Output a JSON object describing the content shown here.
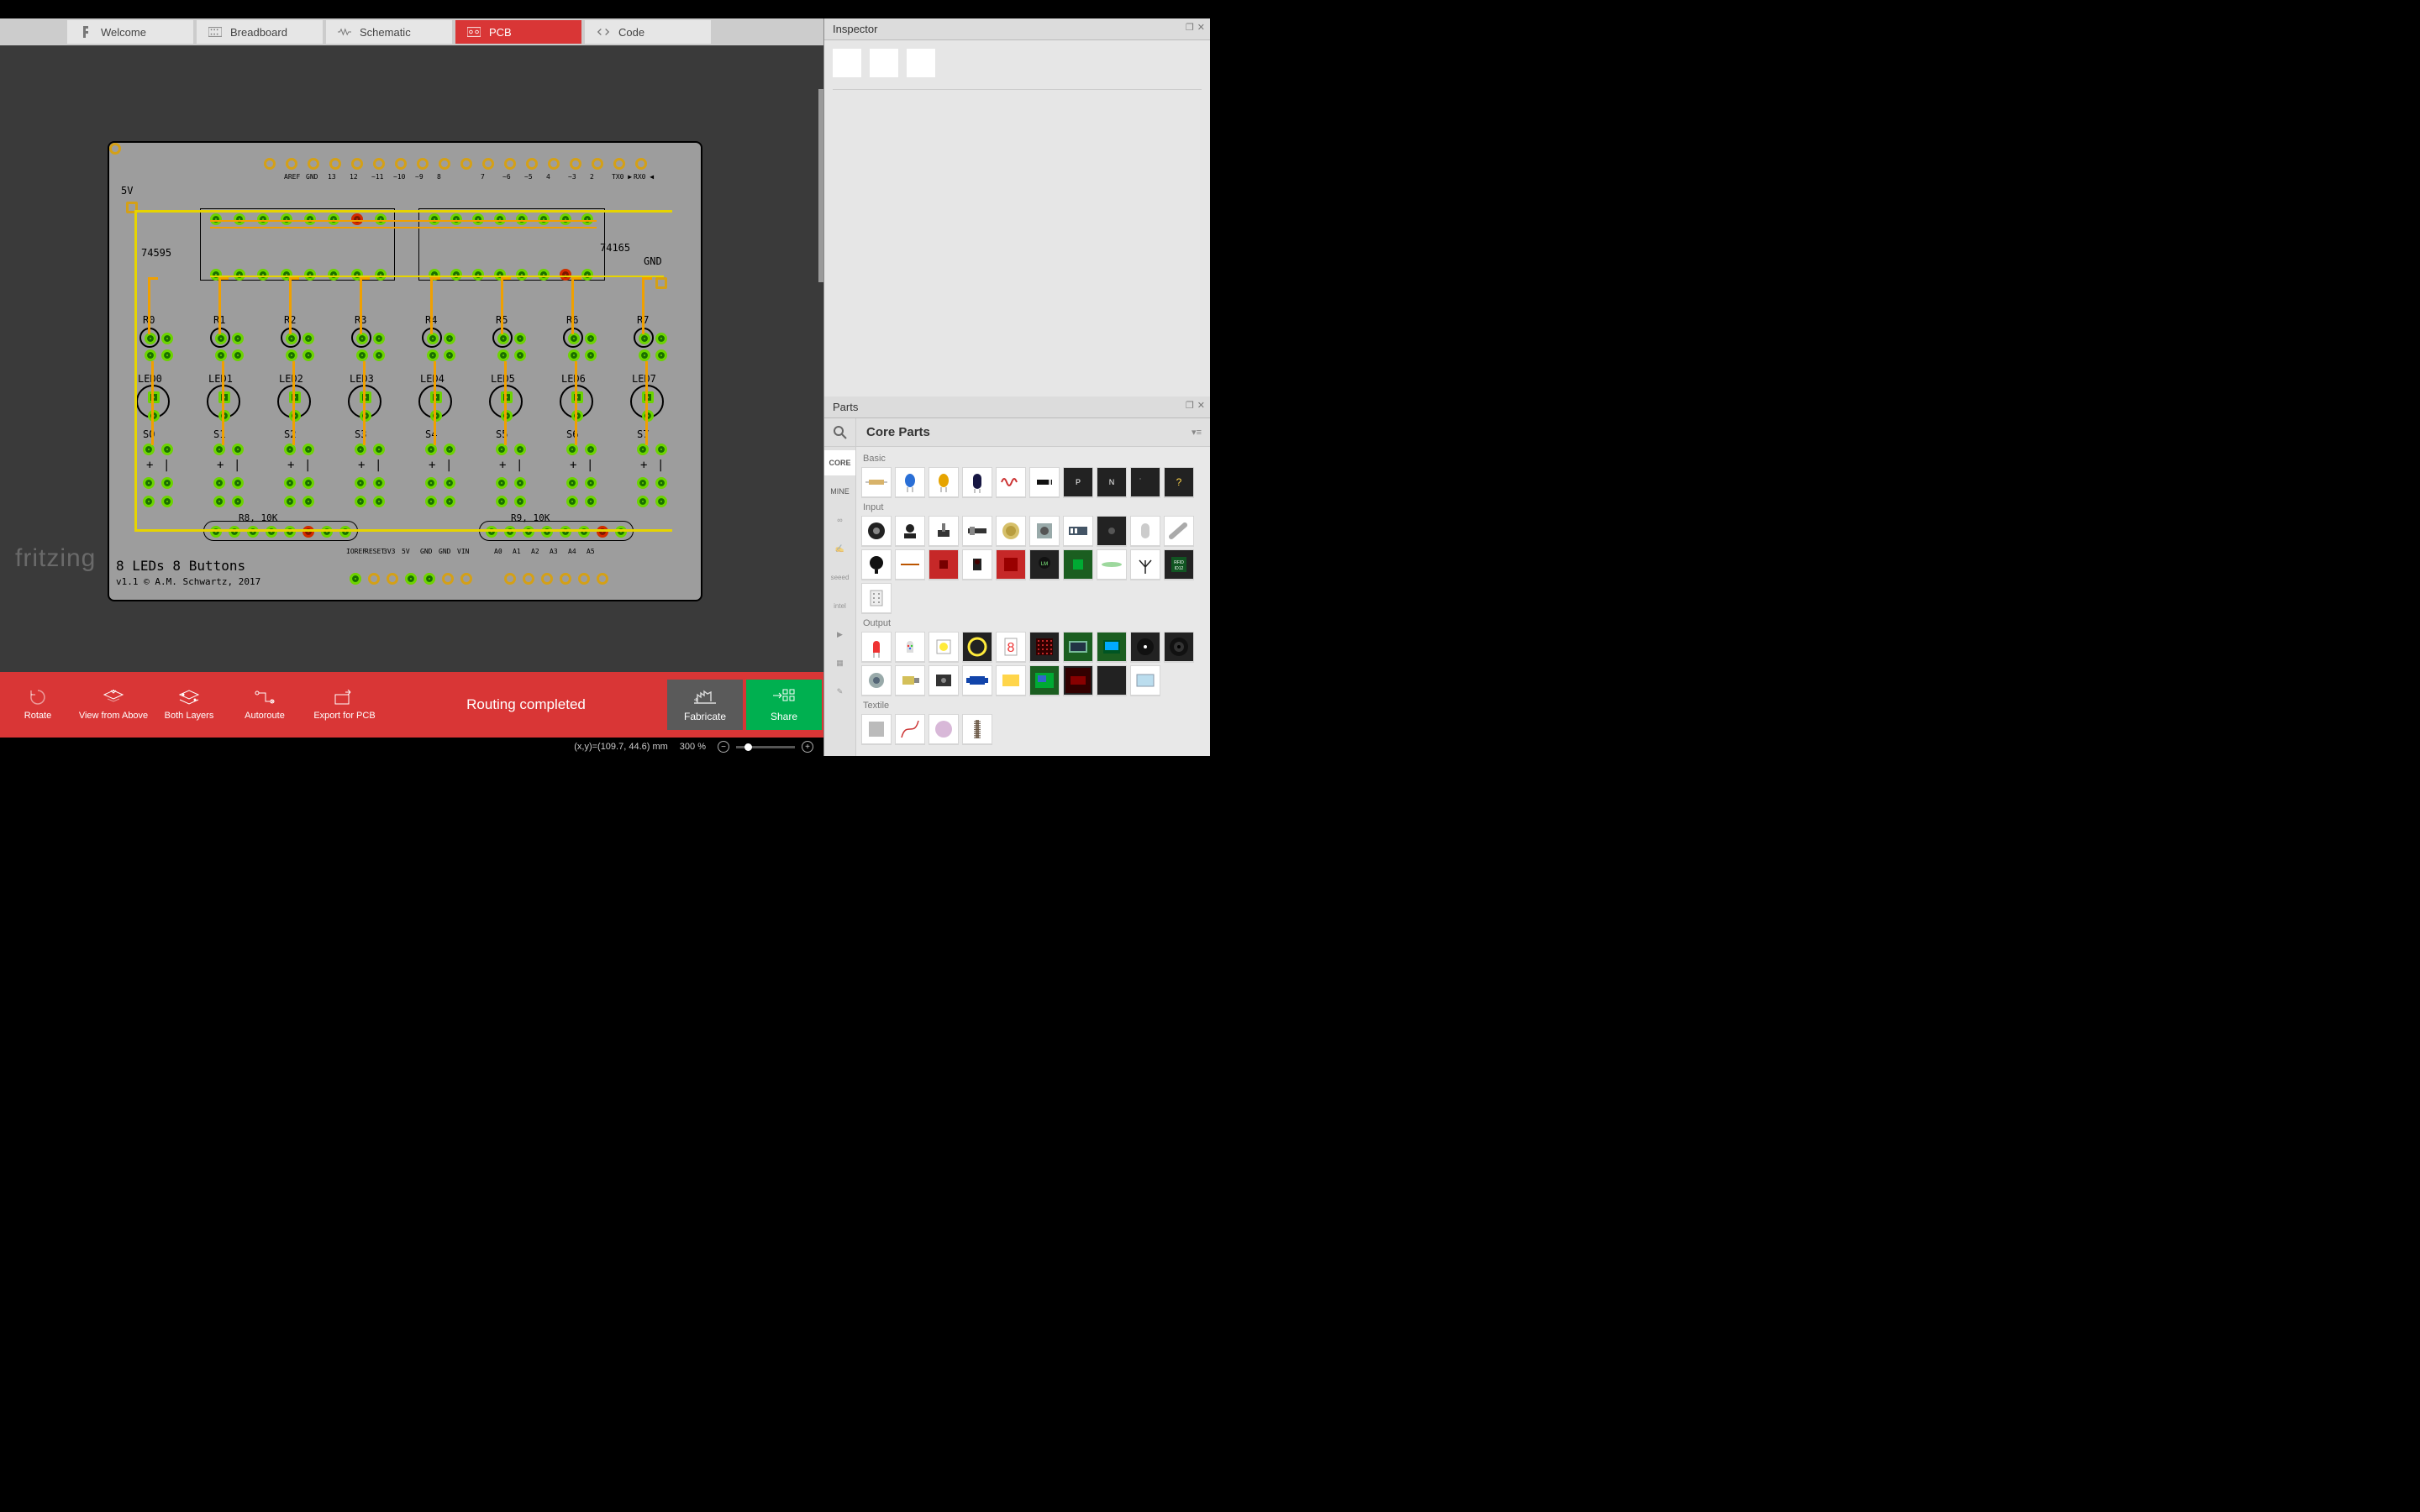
{
  "tabs": {
    "welcome": "Welcome",
    "breadboard": "Breadboard",
    "schematic": "Schematic",
    "pcb": "PCB",
    "code": "Code",
    "active": "pcb"
  },
  "brand": "fritzing",
  "toolbar": {
    "rotate": "Rotate",
    "view_from_above": "View from Above",
    "both_layers": "Both Layers",
    "autoroute": "Autoroute",
    "export_for_pcb": "Export for PCB",
    "fabricate": "Fabricate",
    "share": "Share",
    "routing_status": "Routing completed"
  },
  "status": {
    "coord_label": "(x,y)=(109.7, 44.6) mm",
    "zoom": "300 %"
  },
  "inspector": {
    "title": "Inspector"
  },
  "parts": {
    "panel_title": "Parts",
    "library_title": "Core Parts",
    "bin_tabs": [
      "CORE",
      "MINE",
      "arduino",
      "hand",
      "seeed",
      "intel",
      "play",
      "chip",
      "tools"
    ],
    "sections": {
      "basic": "Basic",
      "input": "Input",
      "output": "Output",
      "textile": "Textile"
    }
  },
  "pcb": {
    "labels": {
      "v5": "5V",
      "ic1": "74595",
      "ic2": "74165",
      "gnd": "GND",
      "r": [
        "R0",
        "R1",
        "R2",
        "R3",
        "R4",
        "R5",
        "R6",
        "R7"
      ],
      "led": [
        "LED0",
        "LED1",
        "LED2",
        "LED3",
        "LED4",
        "LED5",
        "LED6",
        "LED7"
      ],
      "s": [
        "S0",
        "S1",
        "S2",
        "S3",
        "S4",
        "S5",
        "S6",
        "S7"
      ],
      "r8": "R8, 10K",
      "r9": "R9, 10K",
      "title": "8 LEDs 8 Buttons",
      "ver": "v1.1 © A.M. Schwartz, 2017",
      "top_pins": [
        "",
        "AREF",
        "GND",
        "13",
        "12",
        "~11",
        "~10",
        "~9",
        "8",
        "",
        "7",
        "~6",
        "~5",
        "4",
        "~3",
        "2",
        "TX0 ▶",
        "RX0 ◀"
      ],
      "bot_pins": [
        "IOREF",
        "RESET",
        "3V3",
        "5V",
        "GND",
        "GND",
        "VIN",
        "",
        "A0",
        "A1",
        "A2",
        "A3",
        "A4",
        "A5"
      ]
    }
  }
}
